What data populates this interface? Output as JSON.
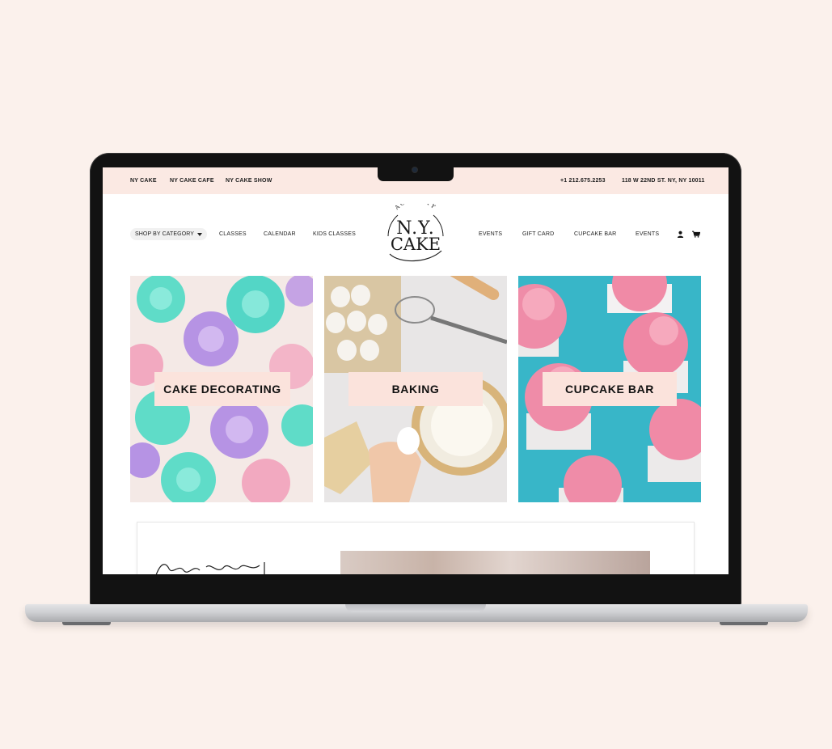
{
  "topbar": {
    "links": [
      "NY CAKE",
      "NY CAKE CAFE",
      "NY CAKE SHOW"
    ],
    "phone": "+1 212.675.2253",
    "address": "118 W 22ND ST. NY, NY 10011"
  },
  "nav": {
    "shop_by_category": "SHOP BY CATEGORY",
    "left_items": [
      "CLASSES",
      "CALENDAR",
      "KIDS CLASSES"
    ],
    "right_items": [
      "EVENTS",
      "GIFT CARD",
      "CUPCAKE BAR",
      "EVENTS"
    ],
    "icons": [
      "user-icon",
      "cart-icon"
    ]
  },
  "logo": {
    "arc_text": "ACADEMY",
    "line1": "N.Y.",
    "line2": "CAKE"
  },
  "categories": [
    {
      "label": "CAKE DECORATING"
    },
    {
      "label": "BAKING"
    },
    {
      "label": "CUPCAKE BAR"
    }
  ],
  "colors": {
    "page_background": "#fbf1ec",
    "topbar_background": "#fbe9e3",
    "label_background": "#fbe3dc",
    "cupcake_backdrop": "#38b6c8"
  }
}
